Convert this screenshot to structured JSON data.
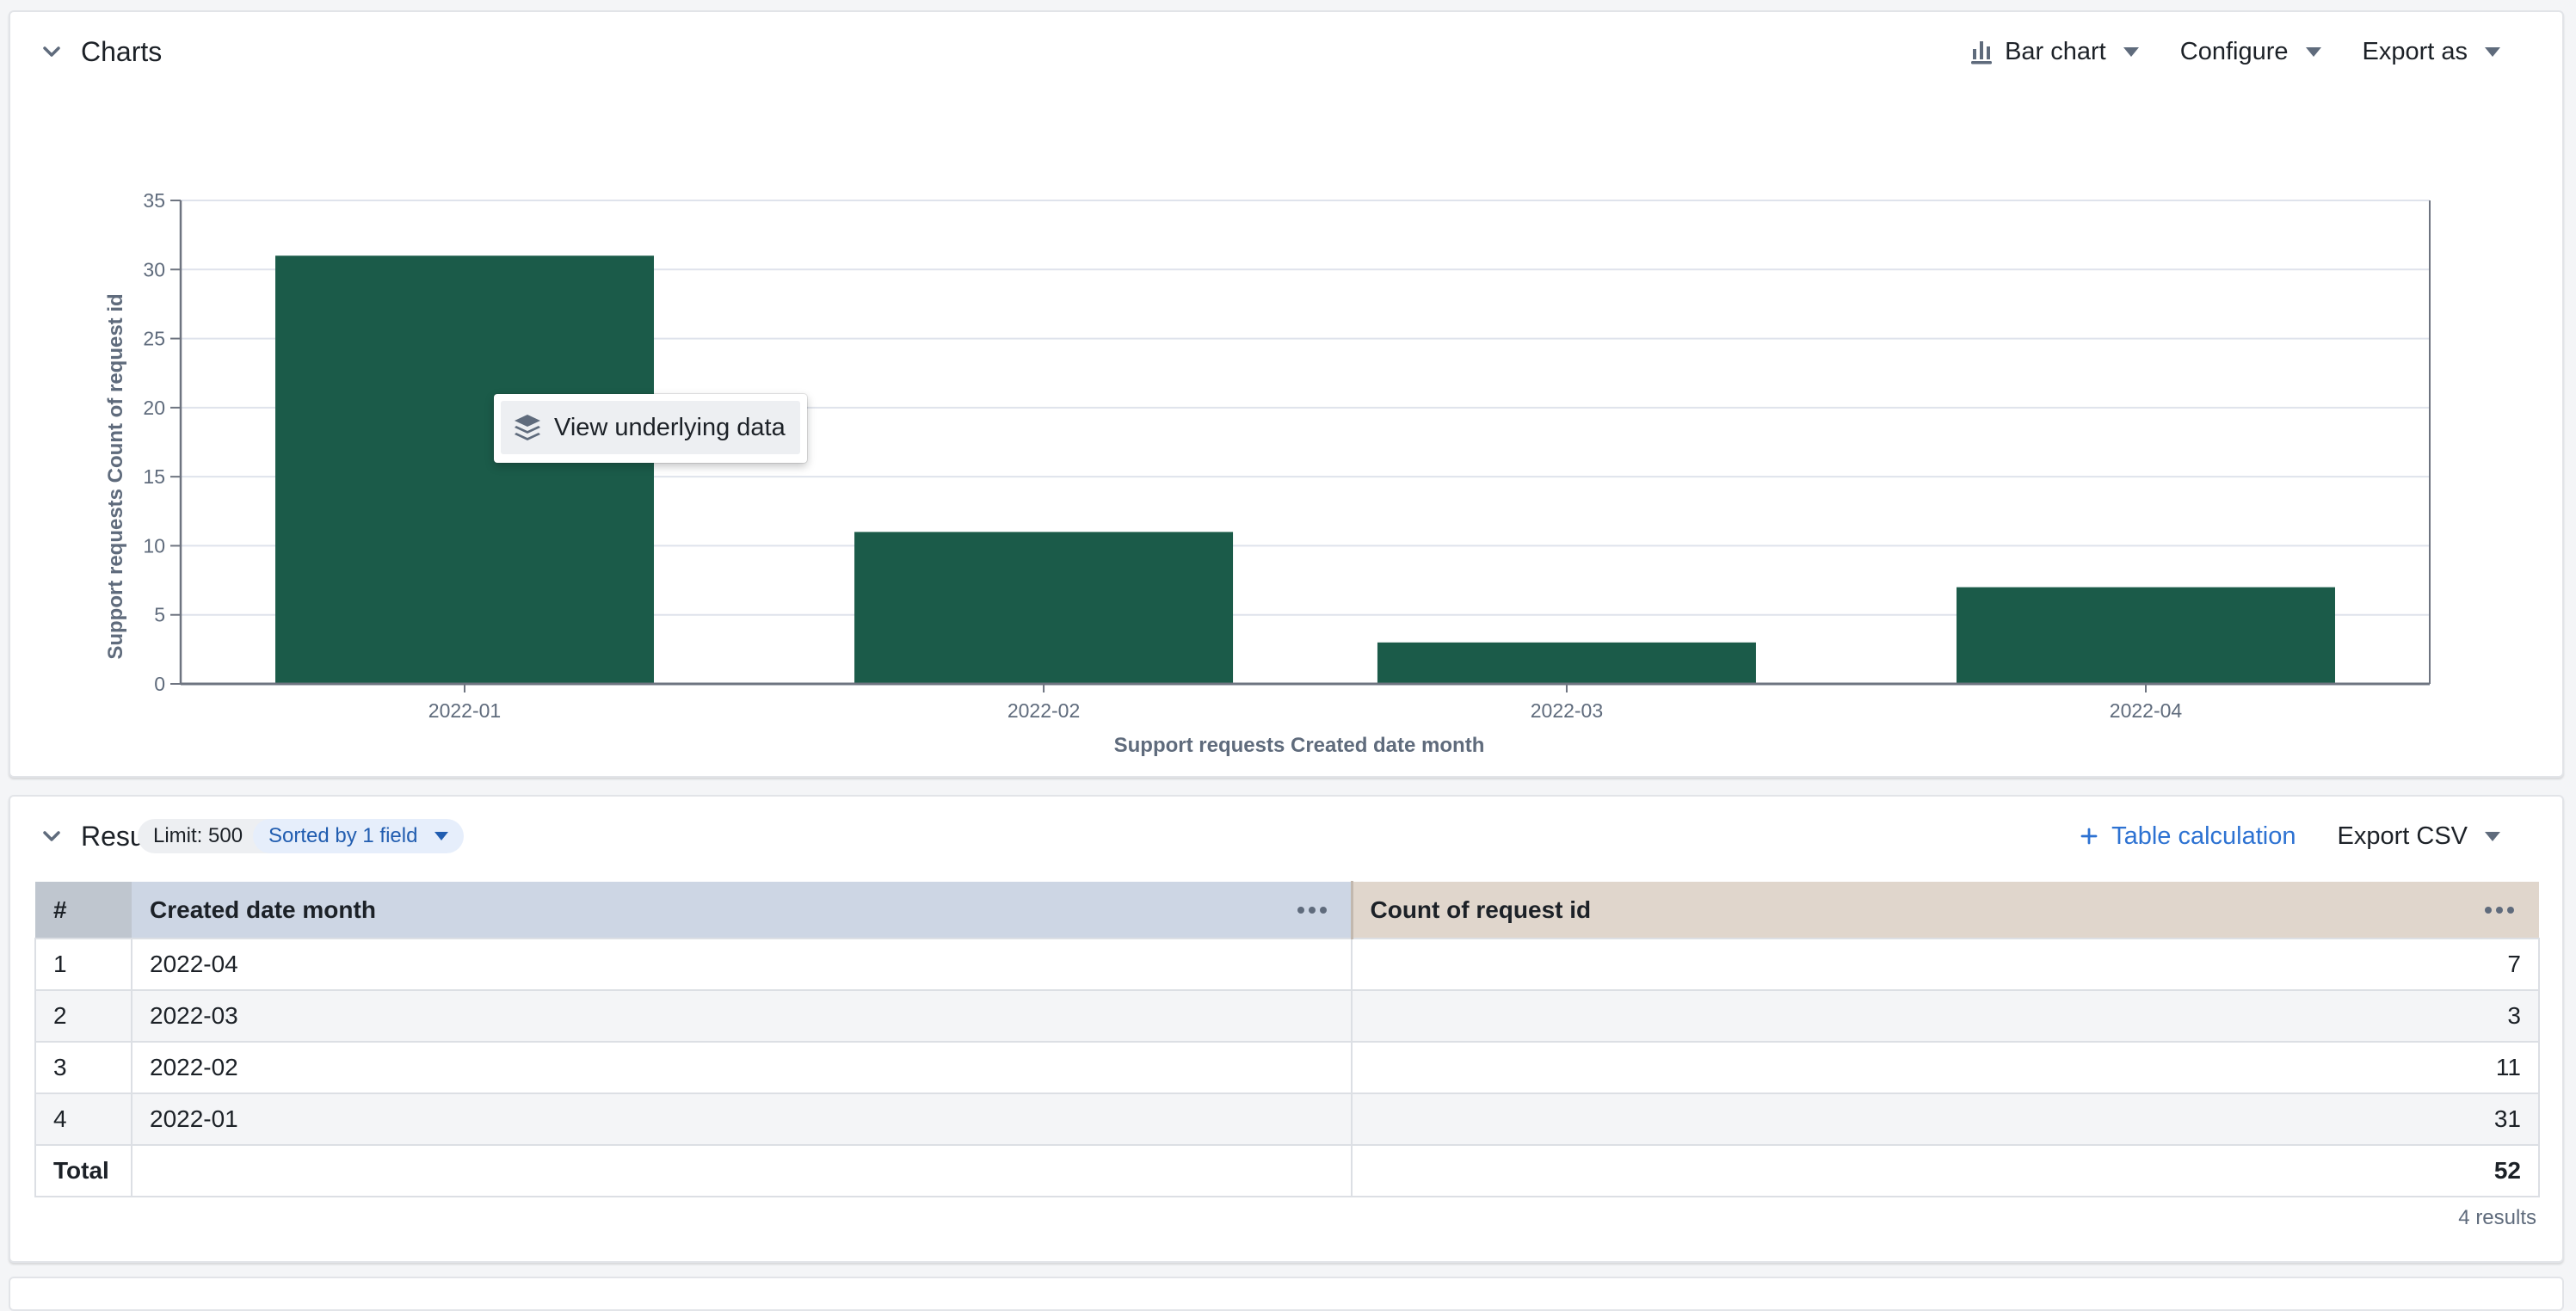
{
  "charts_panel": {
    "title": "Charts",
    "chart_type_button": "Bar chart",
    "configure_button": "Configure",
    "export_button": "Export as",
    "context_menu": {
      "item": "View underlying data",
      "icon": "layers-icon"
    }
  },
  "chart_data": {
    "type": "bar",
    "categories": [
      "2022-01",
      "2022-02",
      "2022-03",
      "2022-04"
    ],
    "category_dates": [
      "2022-01-01",
      "2022-02-01",
      "2022-03-01",
      "2022-04-01"
    ],
    "values": [
      31,
      11,
      3,
      7
    ],
    "series": [
      {
        "name": "Support requests Count of request id",
        "values": [
          31,
          11,
          3,
          7
        ],
        "color": "#1b5b49"
      }
    ],
    "title": "",
    "xlabel": "Support requests Created date month",
    "ylabel": "Support requests Count of request id",
    "ylim": [
      0,
      35
    ],
    "yticks": [
      0,
      5,
      10,
      15,
      20,
      25,
      30,
      35
    ],
    "x_scale": "time",
    "grid": true,
    "legend": "none"
  },
  "results_panel": {
    "title": "Results",
    "limit_label": "Limit: 500",
    "sort_label": "Sorted by 1 field",
    "table_calc_label": "Table calculation",
    "export_csv_label": "Export CSV",
    "columns": {
      "index": "#",
      "dimension": "Created date month",
      "metric": "Count of request id"
    },
    "rows": [
      {
        "index": "1",
        "month": "2022-04",
        "count": "7"
      },
      {
        "index": "2",
        "month": "2022-03",
        "count": "3"
      },
      {
        "index": "3",
        "month": "2022-02",
        "count": "11"
      },
      {
        "index": "4",
        "month": "2022-01",
        "count": "31"
      }
    ],
    "total_label": "Total",
    "total_value": "52",
    "results_count": "4 results"
  },
  "colors": {
    "bar": "#1b5b49",
    "link_blue": "#2d72d2",
    "dimension_header": "#cdd6e4",
    "metric_header": "#e0d6cc"
  }
}
